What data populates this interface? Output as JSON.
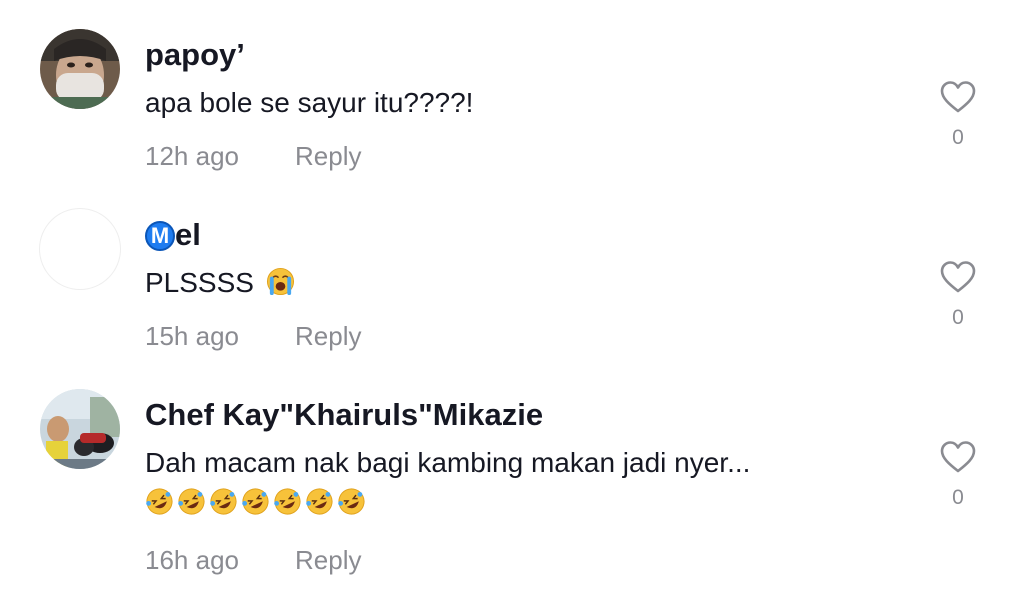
{
  "comments": [
    {
      "username": "papoy’",
      "text": "apa bole se sayur itu????!",
      "time": "12h ago",
      "reply_label": "Reply",
      "likes": "0",
      "avatar": "masked-person-photo"
    },
    {
      "badge": "M",
      "username": "el",
      "text": "PLSSSS",
      "text_emoji": "loudly-crying-face",
      "time": "15h ago",
      "reply_label": "Reply",
      "likes": "0",
      "avatar": "blank"
    },
    {
      "username": "Chef Kay\"Khairuls\"Mikazie",
      "text": "Dah macam nak bagi kambing makan jadi nyer...",
      "emoji_line": [
        "rofl",
        "rofl",
        "rofl",
        "rofl",
        "rofl",
        "rofl",
        "rofl"
      ],
      "time": "16h ago",
      "reply_label": "Reply",
      "likes": "0",
      "avatar": "motorcycle-photo"
    }
  ],
  "colors": {
    "text": "#161823",
    "secondary": "#8a8b91",
    "badge": "#1e7cf0"
  }
}
